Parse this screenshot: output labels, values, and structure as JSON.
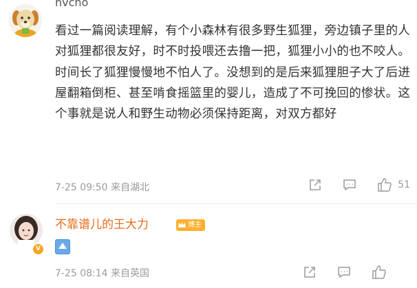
{
  "comments": [
    {
      "username": "nvcho",
      "text": "看过一篇阅读理解，有个小森林有很多野生狐狸，旁边镇子里的人对狐狸都很友好，时不时投喂还去撸一把，狐狸小小的也不咬人。时间长了狐狸慢慢地不怕人了。没想到的是后来狐狸胆子大了后进屋翻箱倒柜、甚至啃食摇篮里的婴儿，造成了不可挽回的惨状。这个事就是说人和野生动物必须保持距离，对双方都好",
      "meta": "7-25 09:50 来自湖北",
      "like_count": "51"
    },
    {
      "username": "不靠谱儿的王大力",
      "badge": "博主",
      "meta": "7-25 08:14 来自英国"
    }
  ],
  "icons": {
    "share": "share-icon",
    "comment": "comment-icon",
    "like": "thumbs-up-icon",
    "verified": "verified-badge-icon",
    "emoji": "up-arrow-emoji-icon"
  },
  "colors": {
    "accent": "#e86c1c",
    "badge": "#ffb02e",
    "meta": "#9a9a9a",
    "emoji": "#6aa9e8"
  }
}
